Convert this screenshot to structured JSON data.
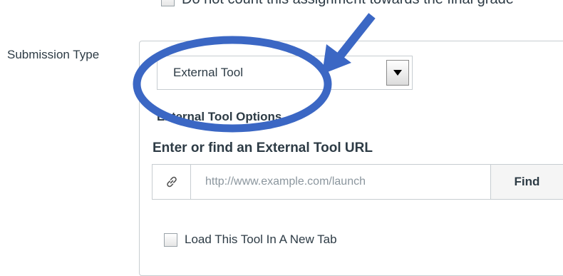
{
  "top_checkbox": {
    "label": "Do not count this assignment towards the final grade",
    "checked": false
  },
  "submission_type": {
    "label": "Submission Type",
    "selected_value": "External Tool"
  },
  "external_tool": {
    "options_heading": "External Tool Options",
    "url_heading": "Enter or find an External Tool URL",
    "url_value": "",
    "url_placeholder": "http://www.example.com/launch",
    "find_label": "Find",
    "link_icon": "link-icon"
  },
  "new_tab_checkbox": {
    "label": "Load This Tool In A New Tab",
    "checked": false
  },
  "colors": {
    "annotation_blue": "#3b67c4",
    "text": "#2d3b45",
    "border": "#c7cdd1",
    "placeholder": "#8b969e"
  }
}
